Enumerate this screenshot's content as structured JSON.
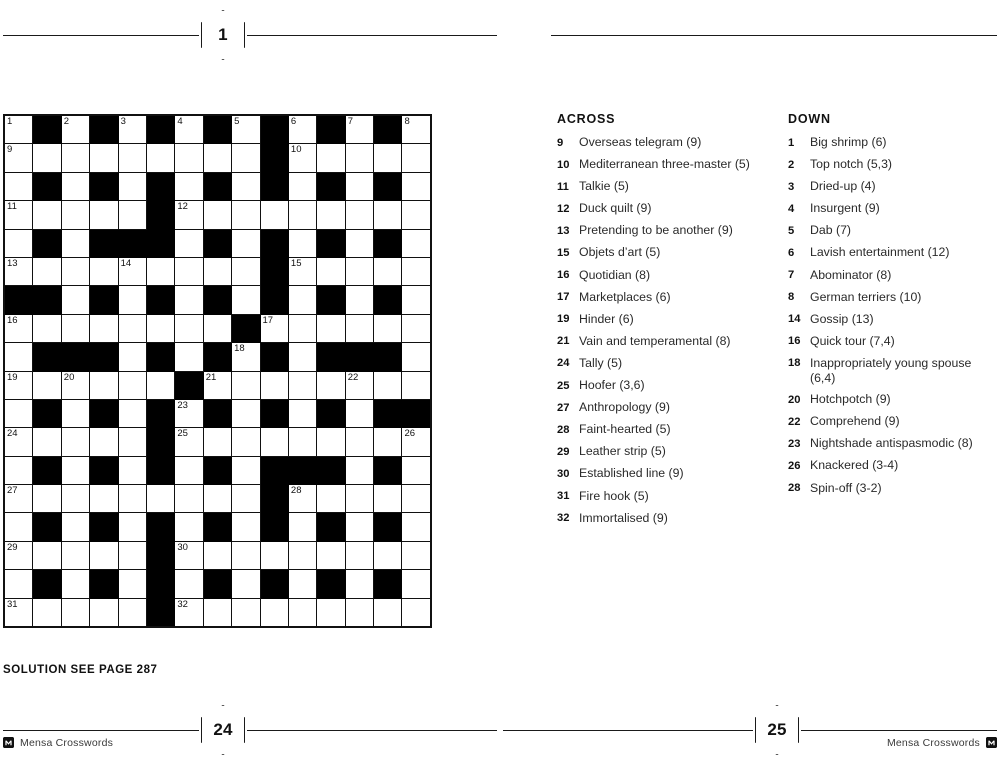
{
  "header": {
    "puzzle_number": "1"
  },
  "grid": {
    "cols": 15,
    "rows": 18,
    "cells": [
      [
        "1",
        "#",
        "2",
        "#",
        "3",
        "#",
        "4",
        "#",
        "5",
        "#",
        "6",
        "#",
        "7",
        "#",
        "8"
      ],
      [
        "9",
        "",
        "",
        "",
        "",
        "",
        "",
        "",
        "",
        "#",
        "10",
        "",
        "",
        "",
        ""
      ],
      [
        "",
        "#",
        "",
        "#",
        "",
        "#",
        "",
        "#",
        "",
        "#",
        "",
        "#",
        "",
        "#",
        ""
      ],
      [
        "11",
        "",
        "",
        "",
        "",
        "#",
        "12",
        "",
        "",
        "",
        "",
        "",
        "",
        "",
        ""
      ],
      [
        "",
        "#",
        "",
        "#",
        "#",
        "#",
        "",
        "#",
        "",
        "#",
        "",
        "#",
        "",
        "#",
        ""
      ],
      [
        "13",
        "",
        "",
        "",
        "14",
        "",
        "",
        "",
        "",
        "#",
        "15",
        "",
        "",
        "",
        ""
      ],
      [
        "#",
        "#",
        "",
        "#",
        "",
        "#",
        "",
        "#",
        "",
        "#",
        "",
        "#",
        "",
        "#",
        ""
      ],
      [
        "16",
        "",
        "",
        "",
        "",
        "",
        "",
        "",
        "#",
        "17",
        "",
        "",
        "",
        "",
        ""
      ],
      [
        "",
        "#",
        "#",
        "#",
        "",
        "#",
        "",
        "#",
        "18",
        "#",
        "",
        "#",
        "#",
        "#",
        ""
      ],
      [
        "19",
        "",
        "20",
        "",
        "",
        "",
        "#",
        "21",
        "",
        "",
        "",
        "",
        "22",
        "",
        ""
      ],
      [
        "",
        "#",
        "",
        "#",
        "",
        "#",
        "23",
        "#",
        "",
        "#",
        "",
        "#",
        "",
        "#",
        "#"
      ],
      [
        "24",
        "",
        "",
        "",
        "",
        "#",
        "25",
        "",
        "",
        "",
        "",
        "",
        "",
        "",
        "26"
      ],
      [
        "",
        "#",
        "",
        "#",
        "",
        "#",
        "",
        "#",
        "",
        "#",
        "#",
        "#",
        "",
        "#",
        ""
      ],
      [
        "27",
        "",
        "",
        "",
        "",
        "",
        "",
        "",
        "",
        "#",
        "28",
        "",
        "",
        "",
        ""
      ],
      [
        "",
        "#",
        "",
        "#",
        "",
        "#",
        "",
        "#",
        "",
        "#",
        "",
        "#",
        "",
        "#",
        ""
      ],
      [
        "29",
        "",
        "",
        "",
        "",
        "#",
        "30",
        "",
        "",
        "",
        "",
        "",
        "",
        "",
        ""
      ],
      [
        "",
        "#",
        "",
        "#",
        "",
        "#",
        "",
        "#",
        "",
        "#",
        "",
        "#",
        "",
        "#",
        ""
      ],
      [
        "31",
        "",
        "",
        "",
        "",
        "#",
        "32",
        "",
        "",
        "",
        "",
        "",
        "",
        "",
        ""
      ]
    ]
  },
  "solution_note": "SOLUTION SEE PAGE 287",
  "across": {
    "heading": "ACROSS",
    "clues": [
      {
        "num": "9",
        "text": "Overseas telegram (9)"
      },
      {
        "num": "10",
        "text": "Mediterranean three-master (5)"
      },
      {
        "num": "11",
        "text": "Talkie (5)"
      },
      {
        "num": "12",
        "text": "Duck quilt (9)"
      },
      {
        "num": "13",
        "text": "Pretending to be another (9)"
      },
      {
        "num": "15",
        "text": "Objets d’art (5)"
      },
      {
        "num": "16",
        "text": "Quotidian (8)"
      },
      {
        "num": "17",
        "text": "Marketplaces (6)"
      },
      {
        "num": "19",
        "text": "Hinder (6)"
      },
      {
        "num": "21",
        "text": "Vain and temperamental (8)"
      },
      {
        "num": "24",
        "text": "Tally (5)"
      },
      {
        "num": "25",
        "text": "Hoofer (3,6)"
      },
      {
        "num": "27",
        "text": "Anthropology (9)"
      },
      {
        "num": "28",
        "text": "Faint-hearted (5)"
      },
      {
        "num": "29",
        "text": "Leather strip (5)"
      },
      {
        "num": "30",
        "text": "Established line (9)"
      },
      {
        "num": "31",
        "text": "Fire hook (5)"
      },
      {
        "num": "32",
        "text": "Immortalised (9)"
      }
    ]
  },
  "down": {
    "heading": "DOWN",
    "clues": [
      {
        "num": "1",
        "text": "Big shrimp (6)"
      },
      {
        "num": "2",
        "text": "Top notch (5,3)"
      },
      {
        "num": "3",
        "text": "Dried-up (4)"
      },
      {
        "num": "4",
        "text": "Insurgent (9)"
      },
      {
        "num": "5",
        "text": "Dab (7)"
      },
      {
        "num": "6",
        "text": "Lavish entertainment (12)"
      },
      {
        "num": "7",
        "text": "Abominator (8)"
      },
      {
        "num": "8",
        "text": "German terriers (10)"
      },
      {
        "num": "14",
        "text": "Gossip (13)"
      },
      {
        "num": "16",
        "text": "Quick tour (7,4)"
      },
      {
        "num": "18",
        "text": "Inappropriately young spouse (6,4)"
      },
      {
        "num": "20",
        "text": "Hotchpotch (9)"
      },
      {
        "num": "22",
        "text": "Comprehend (9)"
      },
      {
        "num": "23",
        "text": "Nightshade antispasmodic (8)"
      },
      {
        "num": "26",
        "text": "Knackered (3-4)"
      },
      {
        "num": "28",
        "text": "Spin-off (3-2)"
      }
    ]
  },
  "footer": {
    "left_page_number": "24",
    "right_page_number": "25",
    "left_label": "Mensa Crosswords",
    "right_label": "Mensa Crosswords"
  },
  "colors": {
    "ink": "#111111",
    "block": "#000000",
    "paper": "#ffffff",
    "clue_text": "#2a2a2a"
  }
}
